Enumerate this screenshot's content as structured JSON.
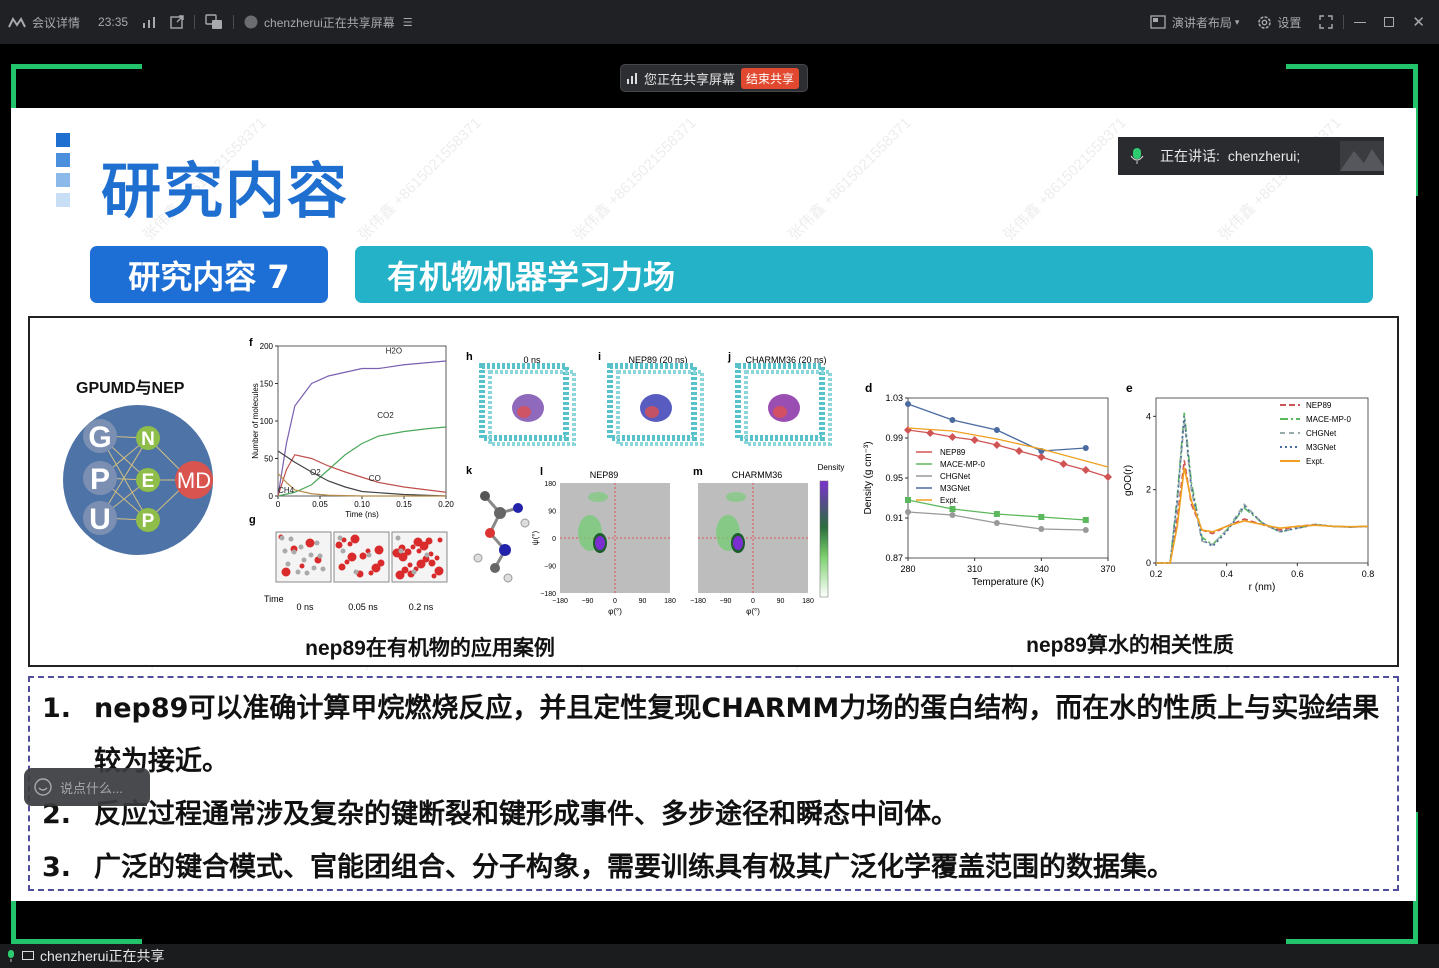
{
  "topbar": {
    "meeting_details": "会议详情",
    "time": "23:35",
    "sharing_status": "chenzherui正在共享屏幕",
    "presenter_layout": "演讲者布局",
    "settings": "设置"
  },
  "sharebar": {
    "status": "您正在共享屏幕",
    "end_button": "结束共享"
  },
  "speaker": {
    "prefix": "正在讲话:",
    "name": "chenzherui;"
  },
  "slide": {
    "title": "研究内容",
    "section_tag": "研究内容 7",
    "section_topic": "有机物机器学习力场",
    "watermark": "张伟鑫 +8615021558371",
    "left_caption": "nep89在有机物的应用案例",
    "right_caption": "nep89算水的相关性质",
    "gpumd": {
      "title": "GPUMD与NEP",
      "letters": [
        "G",
        "P",
        "U"
      ],
      "nep": [
        "N",
        "E",
        "P"
      ],
      "md": "MD"
    },
    "points": [
      {
        "num": "1.",
        "text": "nep89可以准确计算甲烷燃烧反应，并且定性复现CHARMM力场的蛋白结构，而在水的性质上与实验结果较为接近。"
      },
      {
        "num": "2.",
        "text": "反应过程通常涉及复杂的键断裂和键形成事件、多步途径和瞬态中间体。"
      },
      {
        "num": "3.",
        "text": "广泛的键合模式、官能团组合、分子构象，需要训练具有极其广泛化学覆盖范围的数据集。"
      }
    ]
  },
  "chat_placeholder": "说点什么...",
  "bottom_status": "chenzherui正在共享",
  "figure_labels": {
    "panel_f": "f",
    "panel_g": "g",
    "panel_h": "h",
    "panel_i": "i",
    "panel_j": "j",
    "panel_k": "k",
    "panel_l": "l",
    "panel_m": "m",
    "h_title": "0 ns",
    "i_title": "NEP89 (20 ns)",
    "j_title": "CHARMM36 (20 ns)",
    "g_time": "Time",
    "g_t0": "0 ns",
    "g_t1": "0.05 ns",
    "g_t2": "0.2 ns",
    "l_title": "NEP89",
    "m_title": "CHARMM36",
    "density_label": "Density",
    "phi": "φ(°)",
    "psi": "ψ(°)",
    "rama_ticks": [
      "−180",
      "−90",
      "0",
      "90",
      "180"
    ]
  },
  "chart_data": [
    {
      "type": "line",
      "panel": "f",
      "xlabel": "Time (ns)",
      "ylabel": "Number of molecules",
      "xlim": [
        0,
        0.2
      ],
      "ylim": [
        0,
        200
      ],
      "xticks": [
        "0",
        "0.05",
        "0.10",
        "0.15",
        "0.20"
      ],
      "yticks": [
        "0",
        "50",
        "100",
        "150",
        "200"
      ],
      "series": [
        {
          "name": "H2O",
          "color": "#7b5fb0",
          "x": [
            0,
            0.01,
            0.02,
            0.04,
            0.06,
            0.08,
            0.1,
            0.12,
            0.15,
            0.18,
            0.2
          ],
          "values": [
            0,
            70,
            120,
            150,
            160,
            165,
            170,
            170,
            175,
            178,
            180
          ]
        },
        {
          "name": "CO2",
          "color": "#4aa85a",
          "x": [
            0,
            0.02,
            0.04,
            0.06,
            0.08,
            0.1,
            0.12,
            0.15,
            0.18,
            0.2
          ],
          "values": [
            0,
            5,
            15,
            35,
            55,
            70,
            80,
            86,
            90,
            92
          ]
        },
        {
          "name": "CO",
          "color": "#c0504d",
          "x": [
            0,
            0.01,
            0.02,
            0.04,
            0.06,
            0.08,
            0.1,
            0.12,
            0.15,
            0.2
          ],
          "values": [
            0,
            35,
            55,
            50,
            40,
            32,
            25,
            18,
            12,
            5
          ]
        },
        {
          "name": "O2",
          "color": "#444",
          "x": [
            0,
            0.02,
            0.04,
            0.06,
            0.08,
            0.1,
            0.15,
            0.2
          ],
          "values": [
            60,
            45,
            32,
            20,
            12,
            6,
            2,
            0
          ]
        },
        {
          "name": "CH4",
          "color": "#b58a4a",
          "x": [
            0,
            0.01,
            0.02,
            0.04,
            0.06,
            0.1,
            0.2
          ],
          "values": [
            30,
            18,
            8,
            3,
            1,
            0,
            0
          ]
        }
      ]
    },
    {
      "type": "line",
      "panel": "d",
      "xlabel": "Temperature (K)",
      "ylabel": "Density (g cm⁻³)",
      "xlim": [
        280,
        370
      ],
      "ylim": [
        0.87,
        1.03
      ],
      "xticks": [
        "280",
        "310",
        "340",
        "370"
      ],
      "yticks": [
        "0.87",
        "0.91",
        "0.95",
        "0.99",
        "1.03"
      ],
      "series": [
        {
          "name": "NEP89",
          "color": "#d05454",
          "marker": "diamond",
          "x": [
            280,
            290,
            300,
            310,
            320,
            330,
            340,
            350,
            360,
            370
          ],
          "values": [
            0.998,
            0.995,
            0.991,
            0.988,
            0.983,
            0.977,
            0.971,
            0.964,
            0.958,
            0.951
          ]
        },
        {
          "name": "MACE-MP-0",
          "color": "#5cb85c",
          "marker": "square",
          "x": [
            280,
            300,
            320,
            340,
            360
          ],
          "values": [
            0.928,
            0.919,
            0.914,
            0.911,
            0.908
          ]
        },
        {
          "name": "CHGNet",
          "color": "#999",
          "marker": "circle",
          "x": [
            280,
            300,
            320,
            340,
            360
          ],
          "values": [
            0.916,
            0.913,
            0.905,
            0.899,
            0.898
          ]
        },
        {
          "name": "M3GNet",
          "color": "#4a6aa0",
          "marker": "circle",
          "x": [
            280,
            300,
            320,
            340,
            360
          ],
          "values": [
            1.024,
            1.008,
            0.998,
            0.977,
            0.98
          ]
        },
        {
          "name": "Expt.",
          "color": "#f0a020",
          "marker": "none",
          "x": [
            280,
            300,
            320,
            340,
            370
          ],
          "values": [
            1.0,
            0.997,
            0.989,
            0.979,
            0.961
          ]
        }
      ]
    },
    {
      "type": "line",
      "panel": "e",
      "xlabel": "r (nm)",
      "ylabel": "gOO(r)",
      "xlim": [
        0.2,
        0.8
      ],
      "ylim": [
        0,
        4.5
      ],
      "xticks": [
        "0.2",
        "0.4",
        "0.6",
        "0.8"
      ],
      "yticks": [
        "0",
        "2",
        "4"
      ],
      "series": [
        {
          "name": "NEP89",
          "color": "#d05454",
          "dash": "6,3",
          "x": [
            0.2,
            0.24,
            0.26,
            0.28,
            0.3,
            0.33,
            0.36,
            0.4,
            0.45,
            0.5,
            0.55,
            0.6,
            0.65,
            0.7,
            0.75,
            0.8
          ],
          "values": [
            0,
            0,
            1.2,
            2.8,
            1.6,
            0.9,
            0.8,
            1.0,
            1.2,
            1.05,
            0.9,
            1.0,
            1.05,
            1.0,
            0.98,
            1.0
          ]
        },
        {
          "name": "MACE-MP-0",
          "color": "#5cb85c",
          "dash": "8,3,2,3",
          "x": [
            0.2,
            0.24,
            0.26,
            0.28,
            0.3,
            0.33,
            0.36,
            0.4,
            0.45,
            0.5,
            0.55,
            0.6,
            0.65,
            0.7,
            0.75,
            0.8
          ],
          "values": [
            0,
            0,
            1.8,
            4.1,
            2.2,
            0.7,
            0.5,
            0.9,
            1.5,
            1.1,
            0.85,
            0.95,
            1.05,
            1.0,
            0.98,
            1.0
          ]
        },
        {
          "name": "CHGNet",
          "color": "#9aa",
          "dash": "5,4",
          "x": [
            0.2,
            0.24,
            0.26,
            0.28,
            0.3,
            0.33,
            0.36,
            0.4,
            0.45,
            0.5,
            0.55,
            0.6,
            0.65,
            0.7,
            0.75,
            0.8
          ],
          "values": [
            0,
            0,
            1.6,
            3.9,
            2.0,
            0.6,
            0.5,
            0.9,
            1.6,
            1.1,
            0.85,
            0.95,
            1.05,
            1.0,
            0.98,
            1.0
          ]
        },
        {
          "name": "M3GNet",
          "color": "#4a6aa0",
          "dash": "2,3",
          "x": [
            0.2,
            0.24,
            0.26,
            0.28,
            0.3,
            0.33,
            0.36,
            0.4,
            0.45,
            0.5,
            0.55,
            0.6,
            0.65,
            0.7,
            0.75,
            0.8
          ],
          "values": [
            0,
            0,
            1.7,
            4.0,
            2.1,
            0.65,
            0.45,
            0.85,
            1.55,
            1.1,
            0.85,
            0.95,
            1.05,
            1.0,
            0.98,
            1.0
          ]
        },
        {
          "name": "Expt.",
          "color": "#f0a020",
          "dash": "",
          "x": [
            0.2,
            0.24,
            0.26,
            0.28,
            0.3,
            0.33,
            0.36,
            0.4,
            0.45,
            0.5,
            0.55,
            0.6,
            0.65,
            0.7,
            0.75,
            0.8
          ],
          "values": [
            0,
            0,
            1.0,
            2.6,
            1.7,
            0.9,
            0.85,
            1.0,
            1.15,
            1.05,
            0.95,
            1.0,
            1.03,
            1.0,
            0.99,
            1.0
          ]
        }
      ]
    }
  ]
}
